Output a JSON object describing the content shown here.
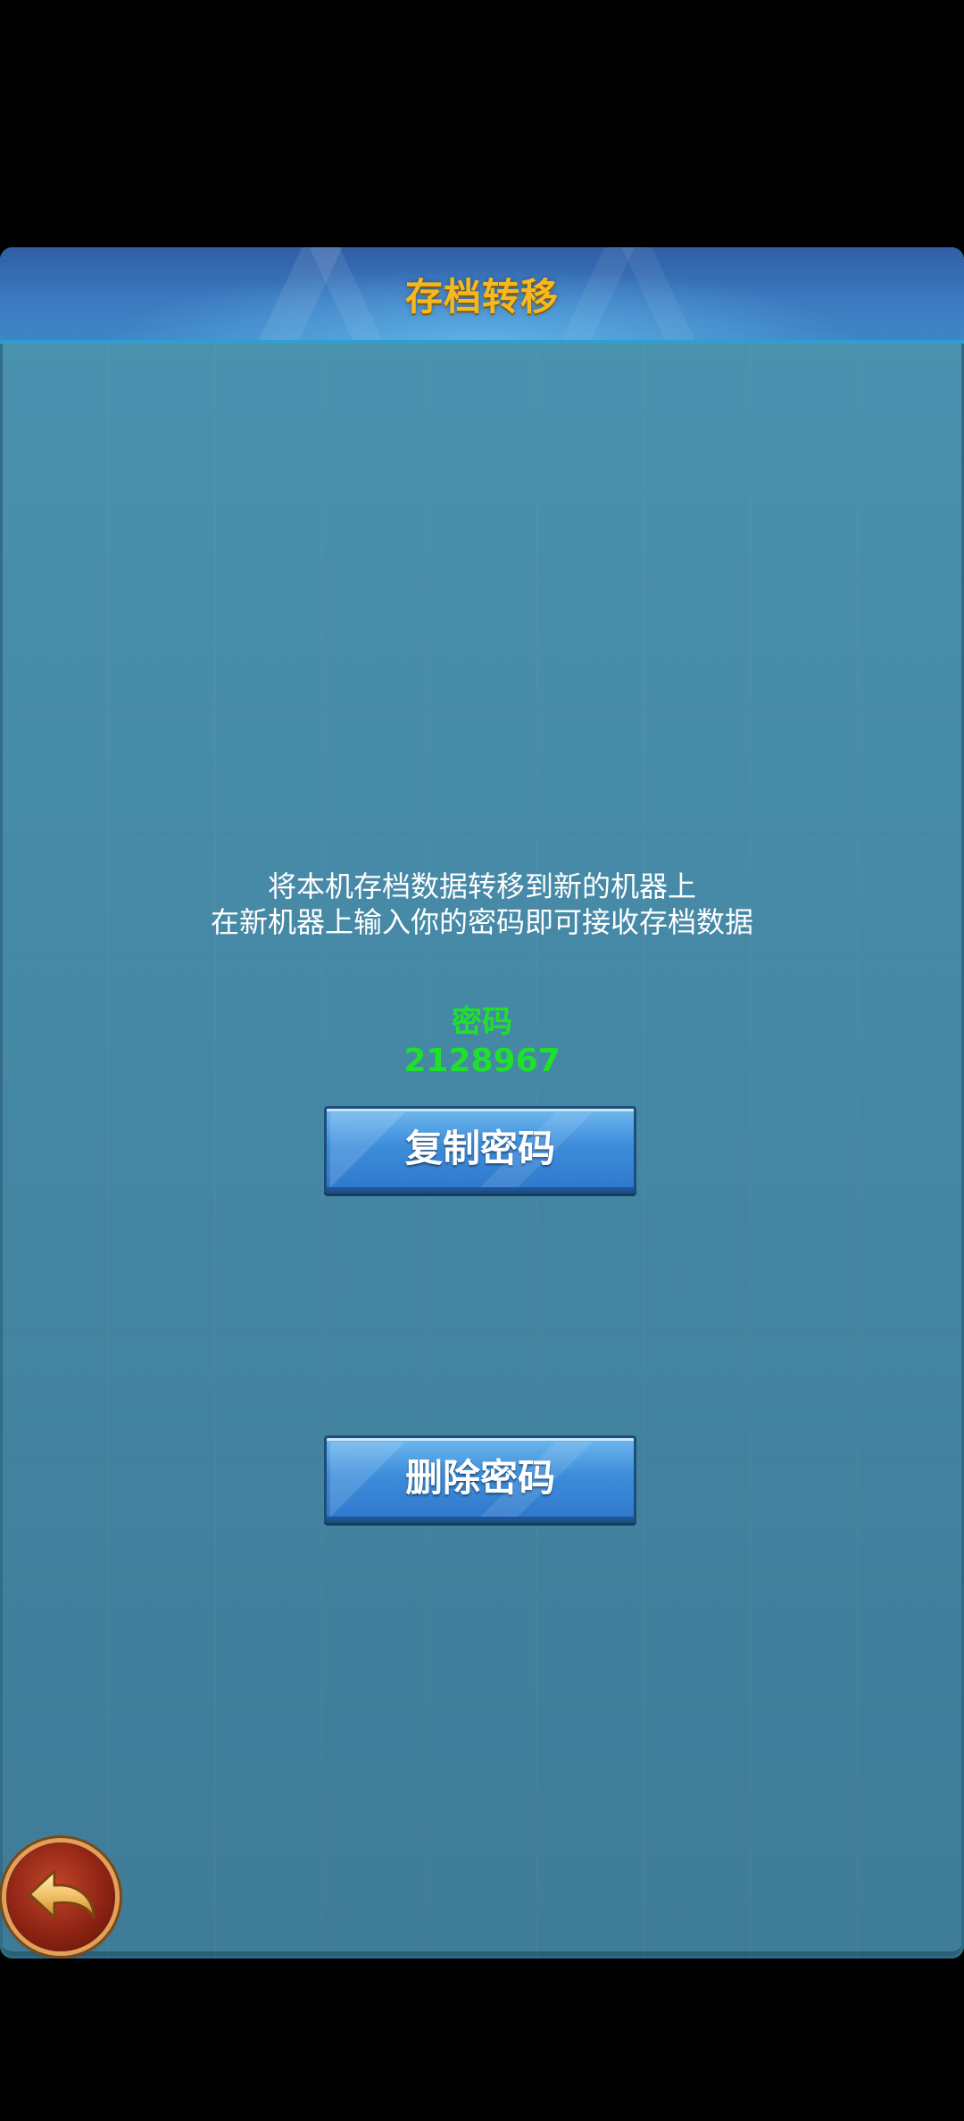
{
  "header": {
    "title": "存档转移"
  },
  "description": {
    "line1": "将本机存档数据转移到新的机器上",
    "line2": "在新机器上输入你的密码即可接收存档数据"
  },
  "password": {
    "label": "密码",
    "value": "2128967"
  },
  "buttons": {
    "copy_label": "复制密码",
    "delete_label": "删除密码"
  },
  "footer": {
    "back_icon": "back-arrow-icon"
  },
  "colors": {
    "title": "#f5b820",
    "password": "#1fe02a",
    "panel": "#4588a5",
    "button": "#3d8ddb"
  }
}
